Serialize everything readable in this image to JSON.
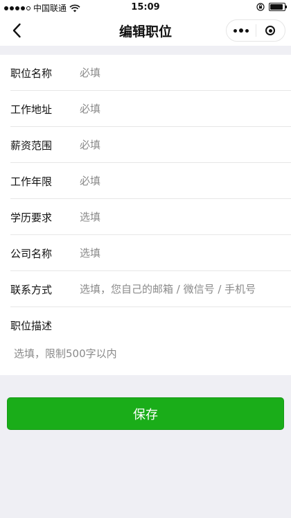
{
  "status_bar": {
    "carrier": "中国联通",
    "time": "15:09"
  },
  "nav": {
    "title": "编辑职位"
  },
  "form": {
    "fields": [
      {
        "label": "职位名称",
        "placeholder": "必填",
        "value": ""
      },
      {
        "label": "工作地址",
        "placeholder": "必填",
        "value": ""
      },
      {
        "label": "薪资范围",
        "placeholder": "必填",
        "value": ""
      },
      {
        "label": "工作年限",
        "placeholder": "必填",
        "value": ""
      },
      {
        "label": "学历要求",
        "placeholder": "选填",
        "value": ""
      },
      {
        "label": "公司名称",
        "placeholder": "选填",
        "value": ""
      },
      {
        "label": "联系方式",
        "placeholder": "选填，您自己的邮箱 / 微信号 / 手机号",
        "value": ""
      }
    ],
    "description": {
      "label": "职位描述",
      "placeholder": "选填，限制500字以内",
      "value": ""
    }
  },
  "actions": {
    "save_label": "保存"
  },
  "colors": {
    "primary": "#1aad19",
    "background": "#efeff4",
    "placeholder": "#8a8a8a"
  },
  "icons": {
    "back": "back-chevron-icon",
    "more": "more-dots-icon",
    "close": "close-miniprogram-icon",
    "wifi": "wifi-icon",
    "lock": "rotation-lock-icon",
    "battery": "battery-icon"
  }
}
